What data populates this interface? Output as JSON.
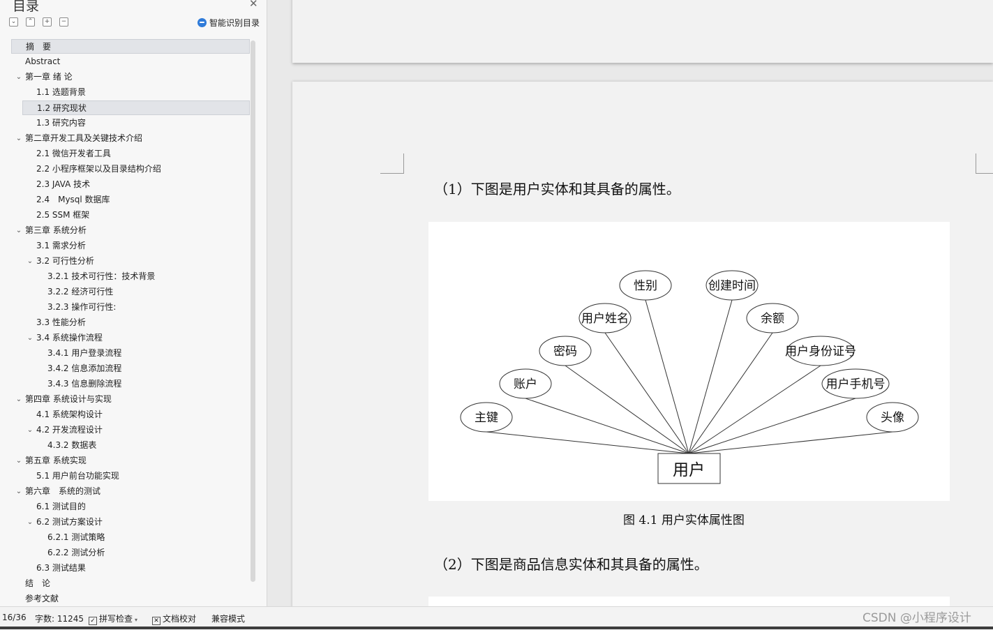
{
  "toc": {
    "title": "目录",
    "close_glyph": "✕",
    "smart_toc_label": "智能识别目录",
    "toolbar": [
      {
        "name": "collapse-all-button",
        "glyph": "⌄"
      },
      {
        "name": "expand-up-button",
        "glyph": "⌃"
      },
      {
        "name": "add-item-button",
        "glyph": "+"
      },
      {
        "name": "remove-item-button",
        "glyph": "−"
      }
    ],
    "items": [
      {
        "label": "摘　要",
        "level": 0,
        "chevron": false,
        "selected": true
      },
      {
        "label": "Abstract",
        "level": 0,
        "chevron": false
      },
      {
        "label": "第一章 绪 论",
        "level": 0,
        "chevron": true
      },
      {
        "label": "1.1 选题背景",
        "level": 1,
        "chevron": false
      },
      {
        "label": "1.2 研究现状",
        "level": 1,
        "chevron": false,
        "selected": true
      },
      {
        "label": "1.3 研究内容",
        "level": 1,
        "chevron": false
      },
      {
        "label": "第二章开发工具及关键技术介绍",
        "level": 0,
        "chevron": true
      },
      {
        "label": "2.1 微信开发者工具",
        "level": 1,
        "chevron": false
      },
      {
        "label": "2.2 小程序框架以及目录结构介绍",
        "level": 1,
        "chevron": false
      },
      {
        "label": "2.3 JAVA 技术",
        "level": 1,
        "chevron": false
      },
      {
        "label": "2.4　Mysql 数据库",
        "level": 1,
        "chevron": false
      },
      {
        "label": "2.5 SSM 框架",
        "level": 1,
        "chevron": false
      },
      {
        "label": "第三章 系统分析",
        "level": 0,
        "chevron": true
      },
      {
        "label": "3.1 需求分析",
        "level": 1,
        "chevron": false
      },
      {
        "label": "3.2 可行性分析",
        "level": 1,
        "chevron": true
      },
      {
        "label": "3.2.1 技术可行性：技术背景",
        "level": 2,
        "chevron": false
      },
      {
        "label": "3.2.2 经济可行性",
        "level": 2,
        "chevron": false
      },
      {
        "label": "3.2.3 操作可行性:",
        "level": 2,
        "chevron": false
      },
      {
        "label": "3.3 性能分析",
        "level": 1,
        "chevron": false
      },
      {
        "label": "3.4 系统操作流程",
        "level": 1,
        "chevron": true
      },
      {
        "label": "3.4.1 用户登录流程",
        "level": 2,
        "chevron": false
      },
      {
        "label": "3.4.2 信息添加流程",
        "level": 2,
        "chevron": false
      },
      {
        "label": "3.4.3 信息删除流程",
        "level": 2,
        "chevron": false
      },
      {
        "label": "第四章 系统设计与实现",
        "level": 0,
        "chevron": true
      },
      {
        "label": "4.1 系统架构设计",
        "level": 1,
        "chevron": false
      },
      {
        "label": "4.2 开发流程设计",
        "level": 1,
        "chevron": true
      },
      {
        "label": "4.3.2 数据表",
        "level": 2,
        "chevron": false
      },
      {
        "label": "第五章 系统实现",
        "level": 0,
        "chevron": true
      },
      {
        "label": "5.1 用户前台功能实现",
        "level": 1,
        "chevron": false
      },
      {
        "label": "第六章　系统的测试",
        "level": 0,
        "chevron": true
      },
      {
        "label": "6.1 测试目的",
        "level": 1,
        "chevron": false
      },
      {
        "label": "6.2 测试方案设计",
        "level": 1,
        "chevron": true
      },
      {
        "label": "6.2.1 测试策略",
        "level": 2,
        "chevron": false
      },
      {
        "label": "6.2.2 测试分析",
        "level": 2,
        "chevron": false
      },
      {
        "label": "6.3 测试结果",
        "level": 1,
        "chevron": false
      },
      {
        "label": "结　论",
        "level": 0,
        "chevron": false
      },
      {
        "label": "参考文献",
        "level": 0,
        "chevron": false
      }
    ]
  },
  "document": {
    "para1": "（1）下图是用户实体和其具备的属性。",
    "figure_caption": "图 4.1 用户实体属性图",
    "para2": "（2）下图是商品信息实体和其具备的属性。",
    "er_diagram": {
      "entity": "用户",
      "attributes": [
        "主键",
        "账户",
        "密码",
        "用户姓名",
        "性别",
        "创建时间",
        "余额",
        "用户身份证号",
        "用户手机号",
        "头像"
      ]
    }
  },
  "status_bar": {
    "page": "16/36",
    "word_count": "字数: 11245",
    "spell_check": "拼写检查",
    "doc_proof": "文档校对",
    "compat_mode": "兼容模式"
  },
  "watermark": "CSDN @小程序设计"
}
